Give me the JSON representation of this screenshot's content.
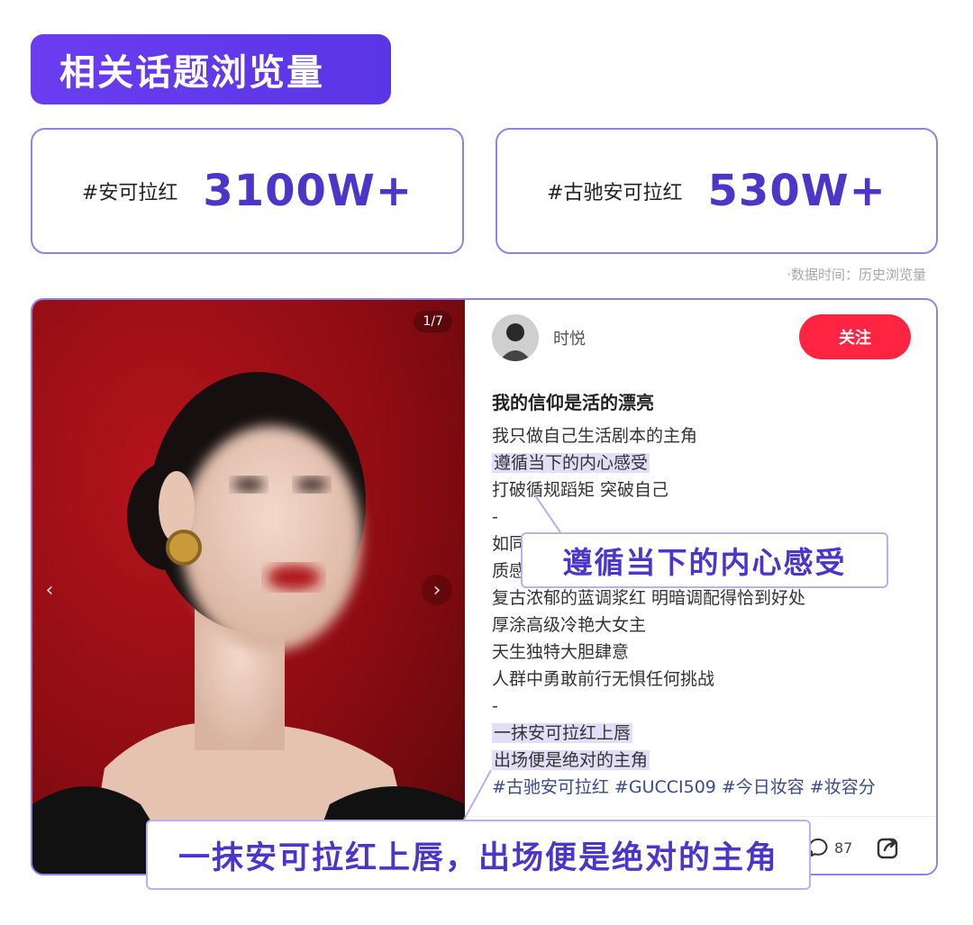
{
  "header": {
    "title": "相关话题浏览量"
  },
  "stats": [
    {
      "tag": "#安可拉红",
      "value": "3100W+"
    },
    {
      "tag": "#古驰安可拉红",
      "value": "530W+"
    }
  ],
  "note": "·数据时间：历史浏览量",
  "post": {
    "page_counter": "1/7",
    "author": {
      "name": "时悦"
    },
    "follow_label": "关注",
    "title": "我的信仰是活的漂亮",
    "lines": [
      "我只做自己生活剧本的主角",
      "遵循当下的内心感受",
      "打破循规蹈矩 突破自己",
      "-",
      "如同",
      "质感",
      "复古浓郁的蓝调浆红 明暗调配得恰到好处",
      "厚涂高级冷艳大女主",
      "天生独特大胆肆意",
      "人群中勇敢前行无惧任何挑战",
      "-",
      "一抹安可拉红上唇",
      "出场便是绝对的主角"
    ],
    "tags": [
      "#古驰安可拉红",
      "#GUCCI509",
      "#今日妆容",
      "#妆容分"
    ],
    "comment_count": "87"
  },
  "callouts": {
    "a": "遵循当下的内心感受",
    "b": "一抹安可拉红上唇，出场便是绝对的主角"
  },
  "colors": {
    "accent": "#5a35e6",
    "follow": "#ff2442",
    "highlight": "#e3def7",
    "backdrop": "#8c0c12"
  },
  "icons": {
    "comment": "comment-icon",
    "share": "share-icon",
    "next": "chevron-right-icon",
    "prev": "chevron-left-icon"
  }
}
